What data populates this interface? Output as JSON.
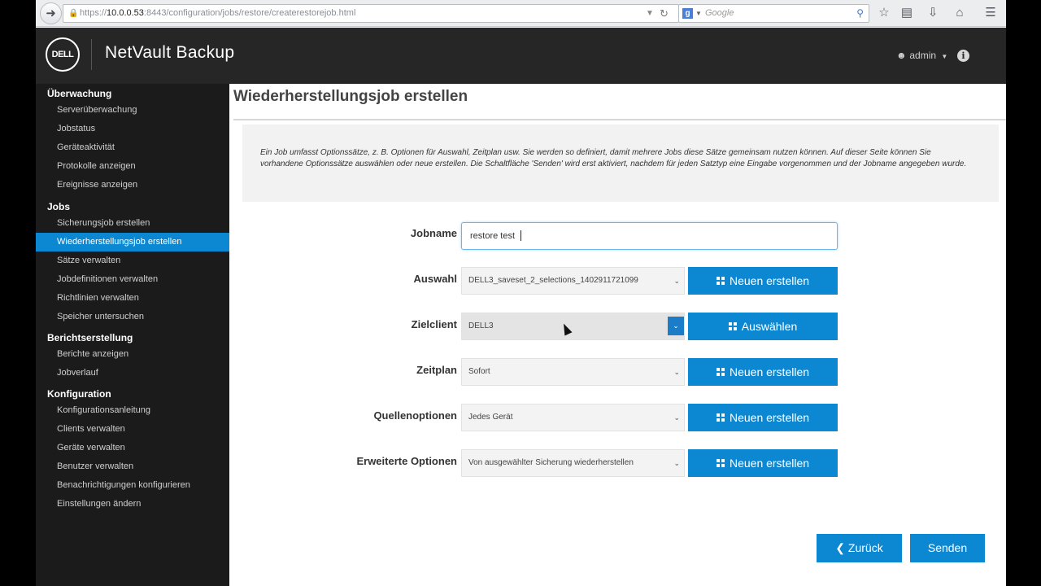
{
  "browser": {
    "url_prefix": "https://",
    "url_host": "10.0.0.53",
    "url_path": ":8443/configuration/jobs/restore/createrestorejob.html",
    "search_placeholder": "Google",
    "search_engine_letter": "g",
    "icons": [
      "back-icon",
      "lock-icon",
      "reload-icon",
      "star-icon",
      "bookmarks-icon",
      "download-icon",
      "home-icon",
      "menu-icon"
    ]
  },
  "header": {
    "logo_text": "DELL",
    "product_name": "NetVault Backup",
    "user_label": "admin"
  },
  "sidebar": {
    "sections": [
      {
        "title": "Überwachung",
        "items": [
          "Serverüberwachung",
          "Jobstatus",
          "Geräteaktivität",
          "Protokolle anzeigen",
          "Ereignisse anzeigen"
        ]
      },
      {
        "title": "Jobs",
        "items": [
          "Sicherungsjob erstellen",
          "Wiederherstellungsjob erstellen",
          "Sätze verwalten",
          "Jobdefinitionen verwalten",
          "Richtlinien verwalten",
          "Speicher untersuchen"
        ]
      },
      {
        "title": "Berichtserstellung",
        "items": [
          "Berichte anzeigen",
          "Jobverlauf"
        ]
      },
      {
        "title": "Konfiguration",
        "items": [
          "Konfigurationsanleitung",
          "Clients verwalten",
          "Geräte verwalten",
          "Benutzer verwalten",
          "Benachrichtigungen konfigurieren",
          "Einstellungen ändern"
        ]
      }
    ],
    "active_item": "Wiederherstellungsjob erstellen"
  },
  "main": {
    "title": "Wiederherstellungsjob erstellen",
    "info_text": "Ein Job umfasst Optionssätze, z. B. Optionen für Auswahl, Zeitplan usw. Sie werden so definiert, damit mehrere Jobs diese Sätze gemeinsam nutzen können. Auf dieser Seite können Sie vorhandene Optionssätze auswählen oder neue erstellen. Die Schaltfläche 'Senden' wird erst aktiviert, nachdem für jeden Satztyp eine Eingabe vorgenommen und der Jobname angegeben wurde.",
    "jobname": {
      "label": "Jobname",
      "value": "restore test"
    },
    "rows": [
      {
        "label": "Auswahl",
        "value": "DELL3_saveset_2_selections_1402911721099",
        "button": "Neuen erstellen"
      },
      {
        "label": "Zielclient",
        "value": "DELL3",
        "button": "Auswählen"
      },
      {
        "label": "Zeitplan",
        "value": "Sofort",
        "button": "Neuen erstellen"
      },
      {
        "label": "Quellenoptionen",
        "value": "Jedes Gerät",
        "button": "Neuen erstellen"
      },
      {
        "label": "Erweiterte Optionen",
        "value": "Von ausgewählter Sicherung wiederherstellen",
        "button": "Neuen erstellen"
      }
    ],
    "back_button": "Zurück",
    "submit_button": "Senden"
  }
}
